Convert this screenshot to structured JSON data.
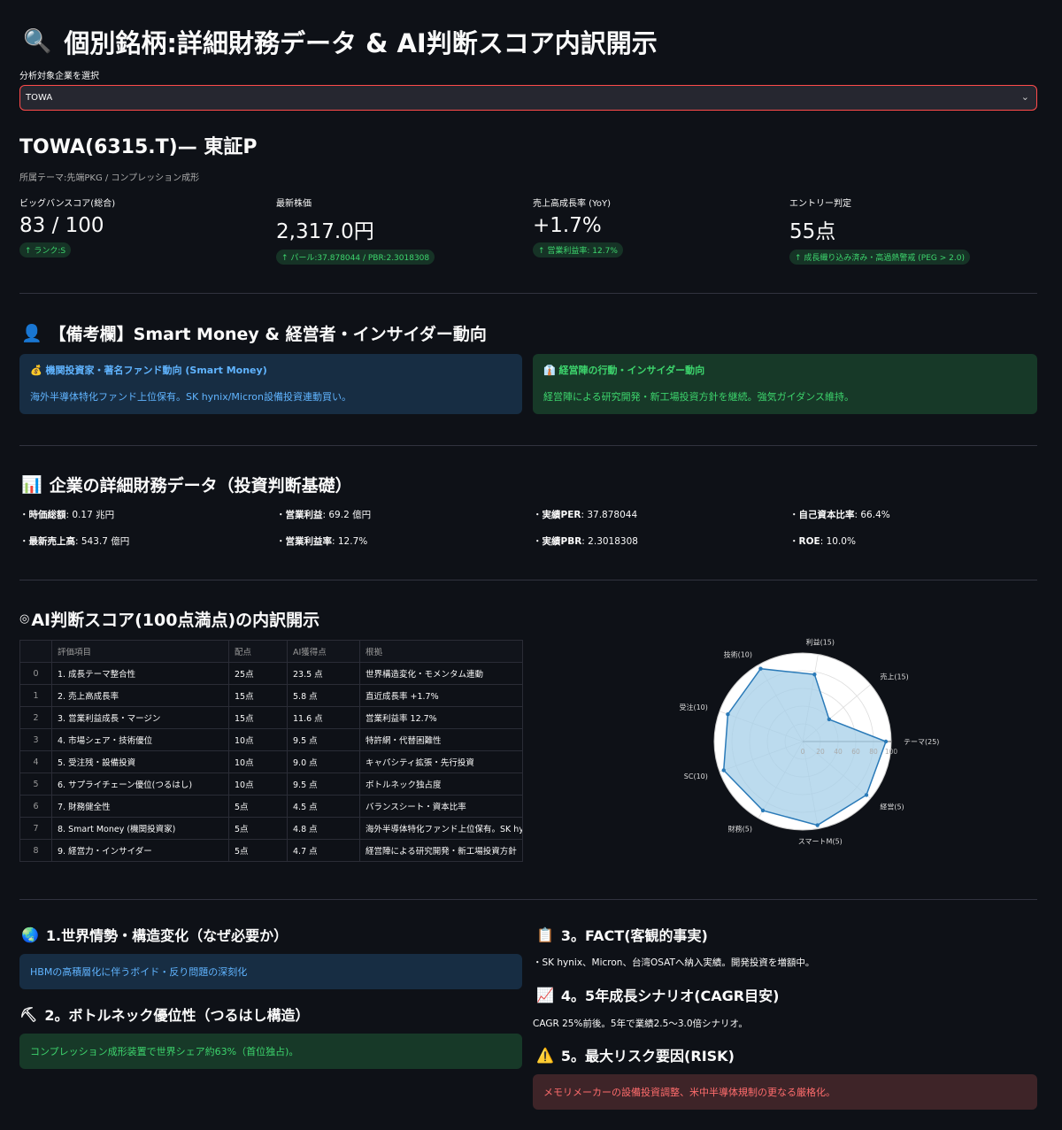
{
  "header": {
    "icon": "magnifier-icon",
    "icon_glyph": "🔍",
    "title": "個別銘柄:詳細財務データ & AI判断スコア内訳開示"
  },
  "selector": {
    "label": "分析対象企業を選択",
    "value": "TOWA"
  },
  "company": {
    "name": "TOWA(6315.T)— 東証P",
    "theme": "所属テーマ:先端PKG / コンプレッション成形"
  },
  "metrics": [
    {
      "label": "ビッグバンスコア(総合)",
      "value": "83 / 100",
      "delta": "↑ ランク:S"
    },
    {
      "label": "最新株価",
      "value": "2,317.0円",
      "delta": "↑ パール:37.878044 / PBR:2.3018308"
    },
    {
      "label": "売上高成長率 (YoY)",
      "value": "+1.7%",
      "delta": "↑ 営業利益率: 12.7%"
    },
    {
      "label": "エントリー判定",
      "value": "55点",
      "delta": "↑ 成長織り込み済み・高過熱警戒 (PEG > 2.0)"
    }
  ],
  "insider": {
    "title": "【備考欄】Smart Money & 経営者・インサイダー動向",
    "icon_glyph": "👤",
    "smart_money": {
      "icon_glyph": "💰",
      "title": "機関投資家・著名ファンド動向 (Smart Money)",
      "text": "海外半導体特化ファンド上位保有。SK hynix/Micron設備投資連動買い。"
    },
    "management": {
      "icon_glyph": "👔",
      "title": "経営陣の行動・インサイダー動向",
      "text": "経営陣による研究開発・新工場投資方針を継続。強気ガイダンス維持。"
    }
  },
  "financials": {
    "title": "企業の詳細財務データ（投資判断基礎）",
    "icon_glyph": "📊",
    "items": [
      {
        "label": "時価総額",
        "value": ": 0.17 兆円"
      },
      {
        "label": "営業利益",
        "value": ": 69.2 億円"
      },
      {
        "label": "実績PER",
        "value": ": 37.878044"
      },
      {
        "label": "自己資本比率",
        "value": ": 66.4%"
      },
      {
        "label": "最新売上高",
        "value": ": 543.7 億円"
      },
      {
        "label": "営業利益率",
        "value": ": 12.7%"
      },
      {
        "label": "実績PBR",
        "value": ": 2.3018308"
      },
      {
        "label": "ROE",
        "value": ": 10.0%"
      }
    ]
  },
  "score": {
    "title": "AI判断スコア(100点満点)の内訳開示",
    "icon_glyph": "◎",
    "columns": [
      "",
      "評価項目",
      "配点",
      "AI獲得点",
      "根拠"
    ],
    "rows": [
      [
        "0",
        "1. 成長テーマ整合性",
        "25点",
        "23.5 点",
        "世界構造変化・モメンタム連動"
      ],
      [
        "1",
        "2. 売上高成長率",
        "15点",
        "5.8 点",
        "直近成長率 +1.7%"
      ],
      [
        "2",
        "3. 営業利益成長・マージン",
        "15点",
        "11.6 点",
        "営業利益率 12.7%"
      ],
      [
        "3",
        "4. 市場シェア・技術優位",
        "10点",
        "9.5 点",
        "特許網・代替困難性"
      ],
      [
        "4",
        "5. 受注残・設備投資",
        "10点",
        "9.0 点",
        "キャパシティ拡張・先行投資"
      ],
      [
        "5",
        "6. サプライチェーン優位(つるはし)",
        "10点",
        "9.5 点",
        "ボトルネック独占度"
      ],
      [
        "6",
        "7. 財務健全性",
        "5点",
        "4.5 点",
        "バランスシート・資本比率"
      ],
      [
        "7",
        "8. Smart Money (機関投資家)",
        "5点",
        "4.8 点",
        "海外半導体特化ファンド上位保有。SK hynix"
      ],
      [
        "8",
        "9. 経営力・インサイダー",
        "5点",
        "4.7 点",
        "経営陣による研究開発・新工場投資方針"
      ]
    ]
  },
  "chart_data": {
    "type": "radar",
    "categories": [
      "テーマ(25)",
      "売上(15)",
      "利益(15)",
      "技術(10)",
      "受注(10)",
      "SC(10)",
      "財務(5)",
      "スマートM(5)",
      "経営(5)"
    ],
    "values": [
      94,
      39,
      77,
      95,
      90,
      95,
      90,
      96,
      94
    ],
    "rlim": [
      0,
      100
    ],
    "tick_labels": [
      "0",
      "20",
      "40",
      "60",
      "80",
      "100"
    ],
    "colors": {
      "fill": "#a6cfe8",
      "line": "#2a7ab8",
      "background": "#ffffff",
      "grid": "#dddddd"
    }
  },
  "world": {
    "icon_glyph": "🌏",
    "title": "1.世界情勢・構造変化（なぜ必要か）",
    "text": "HBMの高積層化に伴うボイド・反り問題の深刻化"
  },
  "bottleneck": {
    "icon_glyph": "⛏",
    "title": "2。ボトルネック優位性（つるはし構造）",
    "text": "コンプレッション成形装置で世界シェア約63%（首位独占)。"
  },
  "fact": {
    "icon_glyph": "📋",
    "title": "3。FACT(客観的事実)",
    "text": "・SK hynix、Micron、台湾OSATへ納入実績。開発投資を増額中。"
  },
  "growth": {
    "icon_glyph": "📈",
    "title": "4。5年成長シナリオ(CAGR目安)",
    "text": "CAGR 25%前後。5年で業績2.5〜3.0倍シナリオ。"
  },
  "risk": {
    "icon_glyph": "⚠️",
    "title": "5。最大リスク要因(RISK)",
    "text": "メモリメーカーの設備投資調整、米中半導体規制の更なる厳格化。"
  }
}
